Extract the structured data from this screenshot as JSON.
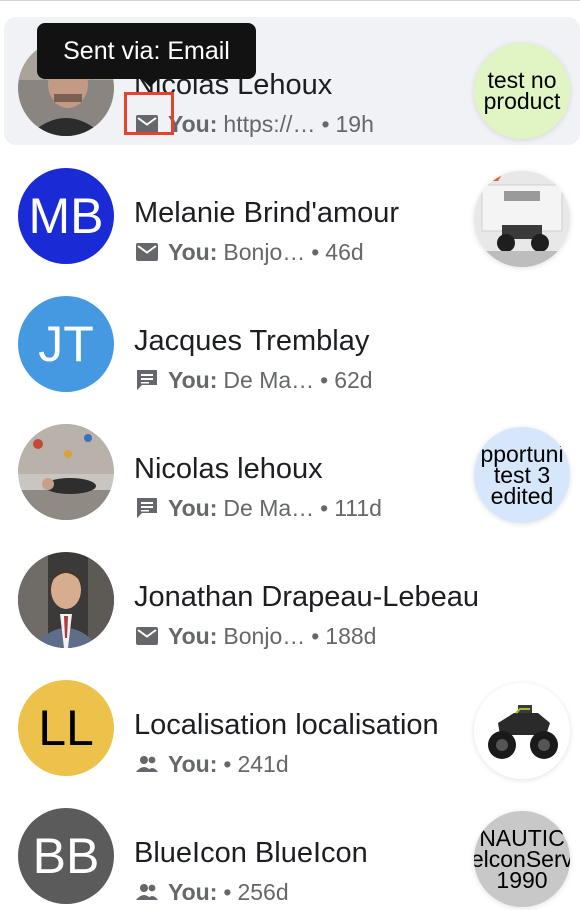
{
  "tooltip": {
    "text": "Sent via: Email"
  },
  "colors": {
    "active_row_bg": "#f0f2f5",
    "highlight": "#e4432f",
    "muted_text": "#65676b"
  },
  "conversations": [
    {
      "name": "Nicolas Lehoux",
      "channel_icon": "email-icon",
      "sender": "You:",
      "snippet": "https://…",
      "dot": "•",
      "age": "19h",
      "avatar_type": "photo",
      "thumb_text": "test no\nproduct",
      "thumb_color": "#e1f5c4"
    },
    {
      "name": "Melanie Brind'amour",
      "channel_icon": "email-icon",
      "sender": "You:",
      "snippet": "Bonjo…",
      "dot": "•",
      "age": "46d",
      "avatar_initials": "MB",
      "avatar_color": "#1a2bd6",
      "thumb_type": "photo-atv-showroom"
    },
    {
      "name": "Jacques Tremblay",
      "channel_icon": "chat-icon",
      "sender": "You:",
      "snippet": "De Ma…",
      "dot": "•",
      "age": "62d",
      "avatar_initials": "JT",
      "avatar_color": "#4599e1"
    },
    {
      "name": "Nicolas lehoux",
      "channel_icon": "chat-icon",
      "sender": "You:",
      "snippet": "De Ma…",
      "dot": "•",
      "age": "111d",
      "avatar_type": "photo",
      "thumb_text": "pportuni\ntest 3\nedited",
      "thumb_color": "#d7e7fb"
    },
    {
      "name": "Jonathan Drapeau-Lebeau",
      "channel_icon": "email-icon",
      "sender": "You:",
      "snippet": "Bonjo…",
      "dot": "•",
      "age": "188d",
      "avatar_type": "photo"
    },
    {
      "name": "Localisation localisation",
      "channel_icon": "group-icon",
      "sender": "You:",
      "snippet": "",
      "dot": "•",
      "age": "241d",
      "avatar_initials": "LL",
      "avatar_color": "#ecc24a",
      "thumb_type": "photo-atv"
    },
    {
      "name": "BlueIcon BlueIcon",
      "channel_icon": "group-icon",
      "sender": "You:",
      "snippet": "",
      "dot": "•",
      "age": "256d",
      "avatar_initials": "BB",
      "avatar_color": "#5b5b5b",
      "thumb_text": "NAUTIC\nelconServ\n1990",
      "thumb_color": "#c8c8c8"
    }
  ]
}
